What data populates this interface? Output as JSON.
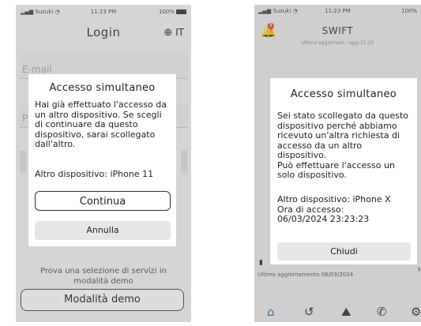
{
  "left": {
    "status": {
      "carrier": "Suzuki",
      "time": "11:23 PM",
      "battery": "100%"
    },
    "title": "Login",
    "lang": "IT",
    "email_placeholder": "E-mail",
    "password_placeholder": "P",
    "modal": {
      "title": "Accesso simultaneo",
      "body": "Hai già effettuato l'accesso da un altro dispositivo. Se scegli di continuare da questo dispositivo, sarai scollegato dall'altro.",
      "other_device": "Altro dispositivo:  iPhone 11",
      "continue": "Continua",
      "cancel": "Annulla"
    },
    "demo_text": "Prova una selezione di servizi in modalità demo",
    "demo_button": "Modalità demo"
  },
  "right": {
    "status": {
      "carrier": "Suzuki",
      "time": "11:23 PM",
      "battery": "100%"
    },
    "notification_badge": "8",
    "title": "SWIFT",
    "last_update": "Ultimo aggiornam.: oggi,11:25",
    "modal": {
      "title": "Accesso simultaneo",
      "body": "Sei stato scollegato da questo dispositivo perché abbiamo ricevuto un'altra richiesta di accesso da un altro dispositivo.\nPuò effettuare l'accesso un solo dispositivo.",
      "other_device": "Altro dispositivo: iPhone X",
      "access_time_label": "Ora di accesso:",
      "access_time_value": "06/03/2024 23:23:23",
      "close": "Chiudi"
    },
    "bottom_update": "Ultimo aggiornamento 06/03/2024",
    "nav_icons": [
      "home-icon",
      "history-icon",
      "map-icon",
      "phone-icon",
      "settings-icon"
    ]
  }
}
